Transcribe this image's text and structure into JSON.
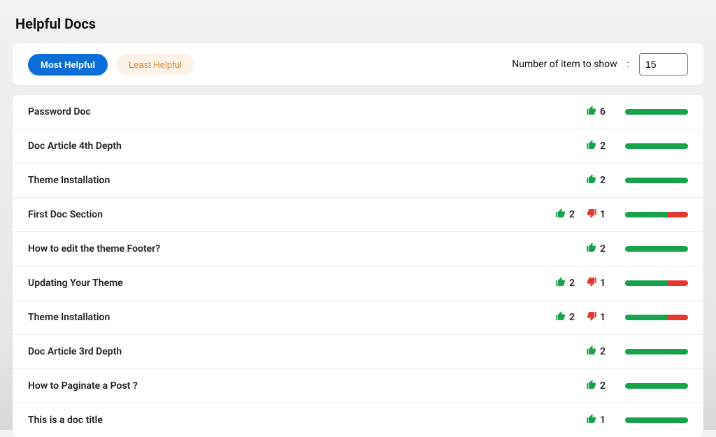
{
  "page": {
    "title": "Helpful Docs"
  },
  "toolbar": {
    "tabs": {
      "most": "Most Helpful",
      "least": "Least Helpful"
    },
    "items_label": "Number of item to show",
    "items_colon": ":",
    "items_value": "15"
  },
  "colors": {
    "up": "#17a34a",
    "down": "#e5392f",
    "accent": "#0b6ed6"
  },
  "docs": [
    {
      "title": "Password Doc",
      "up": 6,
      "down": 0
    },
    {
      "title": "Doc Article 4th Depth",
      "up": 2,
      "down": 0
    },
    {
      "title": "Theme Installation",
      "up": 2,
      "down": 0
    },
    {
      "title": "First Doc Section",
      "up": 2,
      "down": 1
    },
    {
      "title": "How to edit the theme Footer?",
      "up": 2,
      "down": 0
    },
    {
      "title": "Updating Your Theme",
      "up": 2,
      "down": 1
    },
    {
      "title": "Theme Installation",
      "up": 2,
      "down": 1
    },
    {
      "title": "Doc Article 3rd Depth",
      "up": 2,
      "down": 0
    },
    {
      "title": "How to Paginate a Post ?",
      "up": 2,
      "down": 0
    },
    {
      "title": "This is a doc title",
      "up": 1,
      "down": 0
    }
  ]
}
